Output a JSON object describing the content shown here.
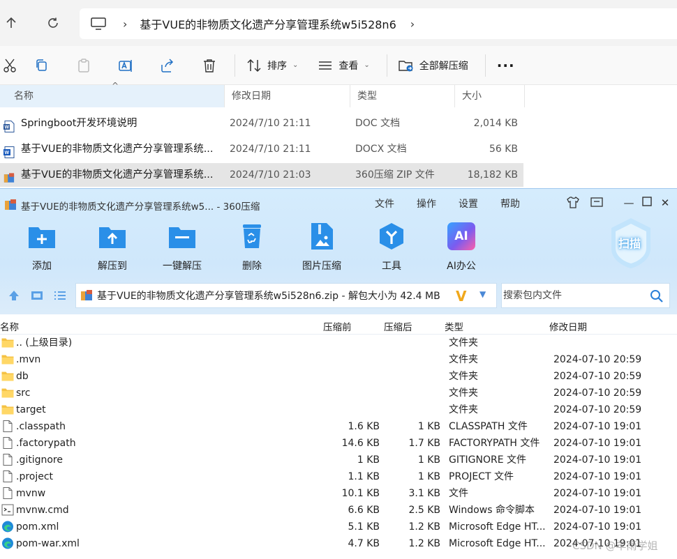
{
  "explorer": {
    "breadcrumb": "基于VUE的非物质文化遗产分享管理系统w5i528n6",
    "commands": {
      "sort": "排序",
      "view": "查看",
      "extract_all": "全部解压缩"
    },
    "columns": [
      "名称",
      "修改日期",
      "类型",
      "大小"
    ],
    "files": [
      {
        "name": "Springboot开发环境说明",
        "date": "2024/7/10 21:11",
        "type": "DOC 文档",
        "size": "2,014 KB",
        "icon": "word-doc-icon"
      },
      {
        "name": "基于VUE的非物质文化遗产分享管理系统...",
        "date": "2024/7/10 21:11",
        "type": "DOCX 文档",
        "size": "56 KB",
        "icon": "word-docx-icon"
      },
      {
        "name": "基于VUE的非物质文化遗产分享管理系统...",
        "date": "2024/7/10 21:03",
        "type": "360压缩 ZIP 文件",
        "size": "18,182 KB",
        "icon": "zip-archive-icon"
      }
    ]
  },
  "archiver": {
    "title": "基于VUE的非物质文化遗产分享管理系统w5... - 360压缩",
    "menu": [
      "文件",
      "操作",
      "设置",
      "帮助"
    ],
    "toolbar": [
      "添加",
      "解压到",
      "一键解压",
      "删除",
      "图片压缩",
      "工具",
      "AI办公"
    ],
    "scan_label": "扫描",
    "path": "基于VUE的非物质文化遗产分享管理系统w5i528n6.zip - 解包大小为 42.4 MB",
    "search_placeholder": "搜索包内文件",
    "columns": [
      "名称",
      "压缩前",
      "压缩后",
      "类型",
      "修改日期"
    ],
    "rows": [
      {
        "name": ".. (上级目录)",
        "before": "",
        "after": "",
        "type": "文件夹",
        "date": "",
        "icon": "folder-icon"
      },
      {
        "name": ".mvn",
        "before": "",
        "after": "",
        "type": "文件夹",
        "date": "2024-07-10 20:59",
        "icon": "folder-icon"
      },
      {
        "name": "db",
        "before": "",
        "after": "",
        "type": "文件夹",
        "date": "2024-07-10 20:59",
        "icon": "folder-icon"
      },
      {
        "name": "src",
        "before": "",
        "after": "",
        "type": "文件夹",
        "date": "2024-07-10 20:59",
        "icon": "folder-icon"
      },
      {
        "name": "target",
        "before": "",
        "after": "",
        "type": "文件夹",
        "date": "2024-07-10 20:59",
        "icon": "folder-icon"
      },
      {
        "name": ".classpath",
        "before": "1.6 KB",
        "after": "1 KB",
        "type": "CLASSPATH 文件",
        "date": "2024-07-10 19:01",
        "icon": "file-icon"
      },
      {
        "name": ".factorypath",
        "before": "14.6 KB",
        "after": "1.7 KB",
        "type": "FACTORYPATH 文件",
        "date": "2024-07-10 19:01",
        "icon": "file-icon"
      },
      {
        "name": ".gitignore",
        "before": "1 KB",
        "after": "1 KB",
        "type": "GITIGNORE 文件",
        "date": "2024-07-10 19:01",
        "icon": "file-icon"
      },
      {
        "name": ".project",
        "before": "1.1 KB",
        "after": "1 KB",
        "type": "PROJECT 文件",
        "date": "2024-07-10 19:01",
        "icon": "file-icon"
      },
      {
        "name": "mvnw",
        "before": "10.1 KB",
        "after": "3.1 KB",
        "type": "文件",
        "date": "2024-07-10 19:01",
        "icon": "file-icon"
      },
      {
        "name": "mvnw.cmd",
        "before": "6.6 KB",
        "after": "2.5 KB",
        "type": "Windows 命令脚本",
        "date": "2024-07-10 19:01",
        "icon": "cmd-script-icon"
      },
      {
        "name": "pom.xml",
        "before": "5.1 KB",
        "after": "1.2 KB",
        "type": "Microsoft Edge HT...",
        "date": "2024-07-10 19:01",
        "icon": "edge-icon"
      },
      {
        "name": "pom-war.xml",
        "before": "4.7 KB",
        "after": "1.2 KB",
        "type": "Microsoft Edge HT...",
        "date": "2024-07-10 19:01",
        "icon": "edge-icon"
      }
    ]
  },
  "watermark": "CSDN @羊雨学姐"
}
